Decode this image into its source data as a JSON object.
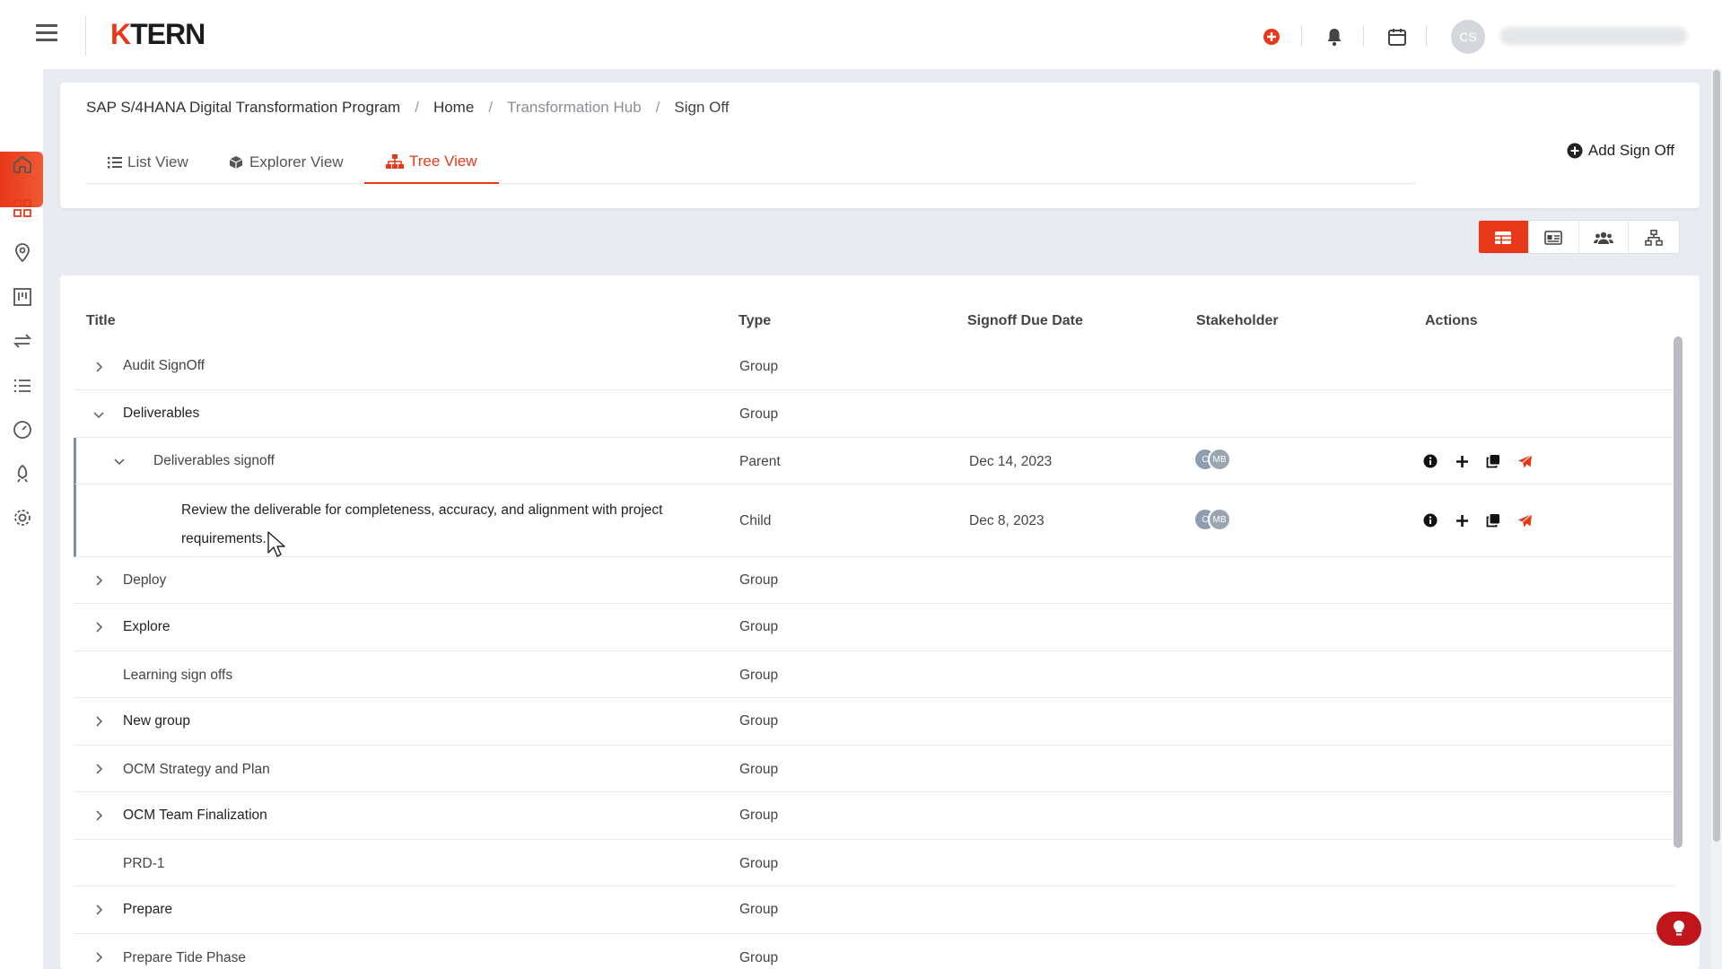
{
  "app": {
    "logo_k": "K",
    "logo_rest": "TERN",
    "user_initials": "CS"
  },
  "breadcrumb": [
    {
      "label": "SAP S/4HANA Digital Transformation Program"
    },
    {
      "label": "Home"
    },
    {
      "label": "Transformation Hub"
    },
    {
      "label": "Sign Off"
    }
  ],
  "breadcrumb_sep": "/",
  "tabs": [
    {
      "label": "List View"
    },
    {
      "label": "Explorer View"
    },
    {
      "label": "Tree View"
    }
  ],
  "add_signoff_label": "Add Sign Off",
  "colors": {
    "accent": "#e8381a",
    "help": "#c0161b"
  },
  "table": {
    "headers": {
      "title": "Title",
      "type": "Type",
      "due": "Signoff Due Date",
      "stakeholder": "Stakeholder",
      "actions": "Actions"
    },
    "rows": [
      {
        "title": "Audit SignOff",
        "type": "Group"
      },
      {
        "title": "Deliverables",
        "type": "Group"
      },
      {
        "title": "Deliverables signoff",
        "type": "Parent",
        "due": "Dec 14, 2023",
        "av1": "C",
        "av2": "MB"
      },
      {
        "title_line1": "Review the deliverable for completeness, accuracy, and alignment with project",
        "title_line2": "requirements.",
        "type": "Child",
        "due": "Dec 8, 2023",
        "av1": "C",
        "av2": "MB"
      },
      {
        "title": "Deploy",
        "type": "Group"
      },
      {
        "title": "Explore",
        "type": "Group"
      },
      {
        "title": "Learning sign offs",
        "type": "Group"
      },
      {
        "title": "New group",
        "type": "Group"
      },
      {
        "title": "OCM Strategy and Plan",
        "type": "Group"
      },
      {
        "title": "OCM Team Finalization",
        "type": "Group"
      },
      {
        "title": "PRD-1",
        "type": "Group"
      },
      {
        "title": "Prepare",
        "type": "Group"
      },
      {
        "title": "Prepare Tide Phase",
        "type": "Group"
      }
    ]
  }
}
